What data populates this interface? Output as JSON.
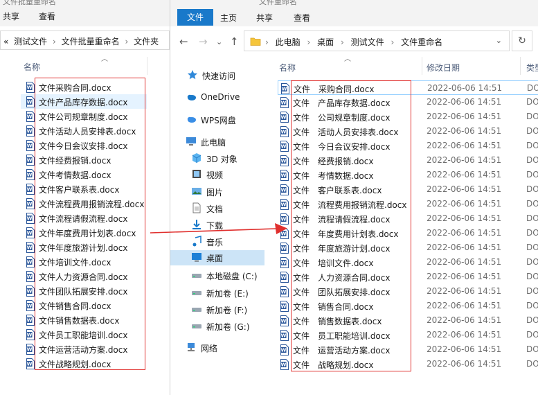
{
  "back_window": {
    "title_fragment": "文件批量重命名",
    "ribbon_tabs": [
      "共享",
      "查看"
    ],
    "breadcrumbs": [
      "«",
      "测试文件",
      "›",
      "文件批量重命名",
      "›",
      "文件夹"
    ],
    "column_name": "名称",
    "files": [
      "文件采购合同.docx",
      "文件产品库存数据.docx",
      "文件公司规章制度.docx",
      "文件活动人员安排表.docx",
      "文件今日会议安排.docx",
      "文件经费报销.docx",
      "文件考情数据.docx",
      "文件客户联系表.docx",
      "文件流程费用报销流程.docx",
      "文件流程请假流程.docx",
      "文件年度费用计划表.docx",
      "文件年度旅游计划.docx",
      "文件培训文件.docx",
      "文件人力资源合同.docx",
      "文件团队拓展安排.docx",
      "文件销售合同.docx",
      "文件销售数据表.docx",
      "文件员工职能培训.docx",
      "文件运营活动方案.docx",
      "文件战略规划.docx"
    ],
    "highlight_index": 1
  },
  "front_window": {
    "title_fragment": "文件重命名",
    "ribbon_tabs": {
      "file": "文件",
      "home": "主页",
      "share": "共享",
      "view": "查看"
    },
    "address": [
      "此电脑",
      "›",
      "桌面",
      "›",
      "测试文件",
      "›",
      "文件重命名"
    ],
    "nav": [
      {
        "label": "快速访问",
        "icon": "star-icon"
      },
      {
        "label": "OneDrive",
        "icon": "cloud-icon"
      },
      {
        "label": "WPS网盘",
        "icon": "wps-cloud-icon"
      },
      {
        "label": "此电脑",
        "icon": "computer-icon"
      },
      {
        "label": "3D 对象",
        "icon": "cube-icon"
      },
      {
        "label": "视频",
        "icon": "video-icon"
      },
      {
        "label": "图片",
        "icon": "picture-icon"
      },
      {
        "label": "文档",
        "icon": "document-icon"
      },
      {
        "label": "下载",
        "icon": "download-icon"
      },
      {
        "label": "音乐",
        "icon": "music-icon"
      },
      {
        "label": "桌面",
        "icon": "desktop-icon",
        "selected": true
      },
      {
        "label": "本地磁盘 (C:)",
        "icon": "drive-icon"
      },
      {
        "label": "新加卷 (E:)",
        "icon": "drive-icon"
      },
      {
        "label": "新加卷 (F:)",
        "icon": "drive-icon"
      },
      {
        "label": "新加卷 (G:)",
        "icon": "drive-icon"
      },
      {
        "label": "网络",
        "icon": "network-icon"
      }
    ],
    "columns": {
      "name": "名称",
      "modified": "修改日期",
      "type": "类型"
    },
    "files": [
      {
        "name": "文件　采购合同.docx",
        "date": "2022-06-06 14:51",
        "type": "DO"
      },
      {
        "name": "文件　产品库存数据.docx",
        "date": "2022-06-06 14:51",
        "type": "DO"
      },
      {
        "name": "文件　公司规章制度.docx",
        "date": "2022-06-06 14:51",
        "type": "DO"
      },
      {
        "name": "文件　活动人员安排表.docx",
        "date": "2022-06-06 14:51",
        "type": "DO"
      },
      {
        "name": "文件　今日会议安排.docx",
        "date": "2022-06-06 14:51",
        "type": "DO"
      },
      {
        "name": "文件　经费报销.docx",
        "date": "2022-06-06 14:51",
        "type": "DO"
      },
      {
        "name": "文件　考情数据.docx",
        "date": "2022-06-06 14:51",
        "type": "DO"
      },
      {
        "name": "文件　客户联系表.docx",
        "date": "2022-06-06 14:51",
        "type": "DO"
      },
      {
        "name": "文件　流程费用报销流程.docx",
        "date": "2022-06-06 14:51",
        "type": "DO"
      },
      {
        "name": "文件　流程请假流程.docx",
        "date": "2022-06-06 14:51",
        "type": "DO"
      },
      {
        "name": "文件　年度费用计划表.docx",
        "date": "2022-06-06 14:51",
        "type": "DO"
      },
      {
        "name": "文件　年度旅游计划.docx",
        "date": "2022-06-06 14:51",
        "type": "DO"
      },
      {
        "name": "文件　培训文件.docx",
        "date": "2022-06-06 14:51",
        "type": "DO"
      },
      {
        "name": "文件　人力资源合同.docx",
        "date": "2022-06-06 14:51",
        "type": "DO"
      },
      {
        "name": "文件　团队拓展安排.docx",
        "date": "2022-06-06 14:51",
        "type": "DO"
      },
      {
        "name": "文件　销售合同.docx",
        "date": "2022-06-06 14:51",
        "type": "DO"
      },
      {
        "name": "文件　销售数据表.docx",
        "date": "2022-06-06 14:51",
        "type": "DO"
      },
      {
        "name": "文件　员工职能培训.docx",
        "date": "2022-06-06 14:51",
        "type": "DO"
      },
      {
        "name": "文件　运营活动方案.docx",
        "date": "2022-06-06 14:51",
        "type": "DO"
      },
      {
        "name": "文件　战略规划.docx",
        "date": "2022-06-06 14:51",
        "type": "DO"
      }
    ],
    "selected_index": 0
  },
  "colors": {
    "accent": "#1979ca",
    "annotation": "#e0302e",
    "selection": "#cce4f7",
    "hover": "#e5f3ff"
  }
}
